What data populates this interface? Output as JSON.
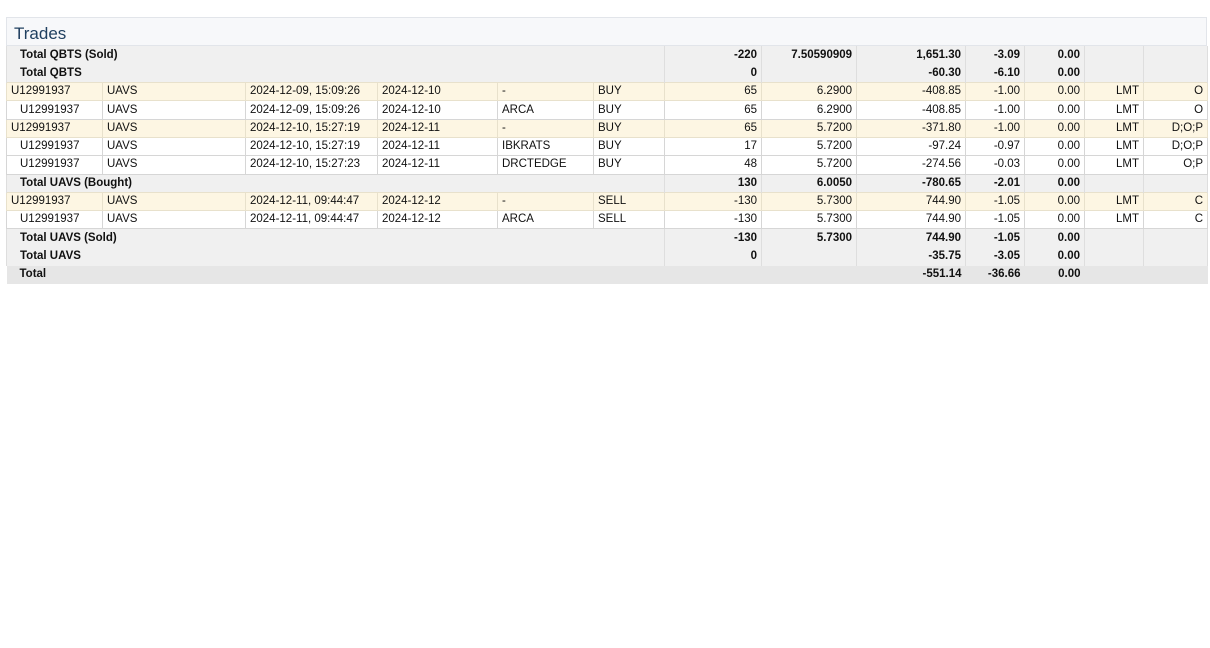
{
  "section": {
    "title": "Trades"
  },
  "rows": [
    {
      "kind": "summary",
      "label": "Total QBTS (Sold)",
      "quantity": "-220",
      "price": "7.50590909",
      "proceeds": "1,651.30",
      "comm": "-3.09",
      "fee": "0.00"
    },
    {
      "kind": "summary",
      "label": "Total QBTS",
      "quantity": "0",
      "price": "",
      "proceeds": "-60.30",
      "comm": "-6.10",
      "fee": "0.00"
    },
    {
      "kind": "order",
      "account": "U12991937",
      "symbol": "UAVS",
      "datetime": "2024-12-09, 15:09:26",
      "settle": "2024-12-10",
      "exchange": "-",
      "side": "BUY",
      "quantity": "65",
      "price": "6.2900",
      "proceeds": "-408.85",
      "comm": "-1.00",
      "fee": "0.00",
      "type": "LMT",
      "code": "O"
    },
    {
      "kind": "exec",
      "account": "U12991937",
      "symbol": "UAVS",
      "datetime": "2024-12-09, 15:09:26",
      "settle": "2024-12-10",
      "exchange": "ARCA",
      "side": "BUY",
      "quantity": "65",
      "price": "6.2900",
      "proceeds": "-408.85",
      "comm": "-1.00",
      "fee": "0.00",
      "type": "LMT",
      "code": "O"
    },
    {
      "kind": "order",
      "account": "U12991937",
      "symbol": "UAVS",
      "datetime": "2024-12-10, 15:27:19",
      "settle": "2024-12-11",
      "exchange": "-",
      "side": "BUY",
      "quantity": "65",
      "price": "5.7200",
      "proceeds": "-371.80",
      "comm": "-1.00",
      "fee": "0.00",
      "type": "LMT",
      "code": "D;O;P"
    },
    {
      "kind": "exec",
      "account": "U12991937",
      "symbol": "UAVS",
      "datetime": "2024-12-10, 15:27:19",
      "settle": "2024-12-11",
      "exchange": "IBKRATS",
      "side": "BUY",
      "quantity": "17",
      "price": "5.7200",
      "proceeds": "-97.24",
      "comm": "-0.97",
      "fee": "0.00",
      "type": "LMT",
      "code": "D;O;P"
    },
    {
      "kind": "exec",
      "account": "U12991937",
      "symbol": "UAVS",
      "datetime": "2024-12-10, 15:27:23",
      "settle": "2024-12-11",
      "exchange": "DRCTEDGE",
      "side": "BUY",
      "quantity": "48",
      "price": "5.7200",
      "proceeds": "-274.56",
      "comm": "-0.03",
      "fee": "0.00",
      "type": "LMT",
      "code": "O;P"
    },
    {
      "kind": "summary",
      "label": "Total UAVS (Bought)",
      "quantity": "130",
      "price": "6.0050",
      "proceeds": "-780.65",
      "comm": "-2.01",
      "fee": "0.00"
    },
    {
      "kind": "order",
      "account": "U12991937",
      "symbol": "UAVS",
      "datetime": "2024-12-11, 09:44:47",
      "settle": "2024-12-12",
      "exchange": "-",
      "side": "SELL",
      "quantity": "-130",
      "price": "5.7300",
      "proceeds": "744.90",
      "comm": "-1.05",
      "fee": "0.00",
      "type": "LMT",
      "code": "C"
    },
    {
      "kind": "exec",
      "account": "U12991937",
      "symbol": "UAVS",
      "datetime": "2024-12-11, 09:44:47",
      "settle": "2024-12-12",
      "exchange": "ARCA",
      "side": "SELL",
      "quantity": "-130",
      "price": "5.7300",
      "proceeds": "744.90",
      "comm": "-1.05",
      "fee": "0.00",
      "type": "LMT",
      "code": "C"
    },
    {
      "kind": "summary",
      "label": "Total UAVS (Sold)",
      "quantity": "-130",
      "price": "5.7300",
      "proceeds": "744.90",
      "comm": "-1.05",
      "fee": "0.00"
    },
    {
      "kind": "summary",
      "label": "Total UAVS",
      "quantity": "0",
      "price": "",
      "proceeds": "-35.75",
      "comm": "-3.05",
      "fee": "0.00"
    },
    {
      "kind": "grand",
      "label": "Total",
      "proceeds": "-551.14",
      "comm": "-36.66",
      "fee": "0.00"
    }
  ]
}
